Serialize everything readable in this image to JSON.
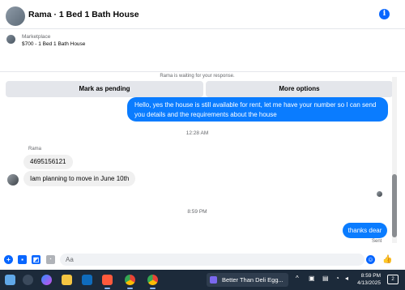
{
  "header": {
    "title": "Rama · 1 Bed 1 Bath House",
    "info_icon": "info-icon"
  },
  "listing": {
    "source": "Marketplace",
    "price_title": "$700 - 1 Bed 1 Bath House",
    "mark_pending_label": "Mark as pending",
    "more_options_label": "More options"
  },
  "conversation": {
    "waiting_notice": "Rama is waiting for your response.",
    "messages": [
      {
        "direction": "outgoing",
        "text": "Hello, yes the house is still available for rent, let me have your number so I can send you details and the requirements about the house"
      },
      {
        "direction": "incoming",
        "text": "4695156121"
      },
      {
        "direction": "incoming",
        "text": "Iam planning to move in June 10th"
      },
      {
        "direction": "outgoing",
        "text": "thanks dear"
      }
    ],
    "timestamp_1": "12:28 AM",
    "sender_name": "Rama",
    "timestamp_2": "8:59 PM",
    "sent_status": "Sent"
  },
  "composer": {
    "placeholder": "Aa",
    "icons": [
      "plus-icon",
      "photo-icon",
      "sticker-icon",
      "gif-icon",
      "emoji-icon",
      "like-icon"
    ]
  },
  "taskbar": {
    "active_task_label": "Better Than Deli Egg...",
    "time": "8:59 PM",
    "date": "4/13/2025",
    "notification_count": "2"
  },
  "colors": {
    "accent": "#0866ff",
    "outgoing_bubble": "#0a7cff",
    "incoming_bubble": "#f0f0f0",
    "taskbar": "#1c2a3a"
  }
}
